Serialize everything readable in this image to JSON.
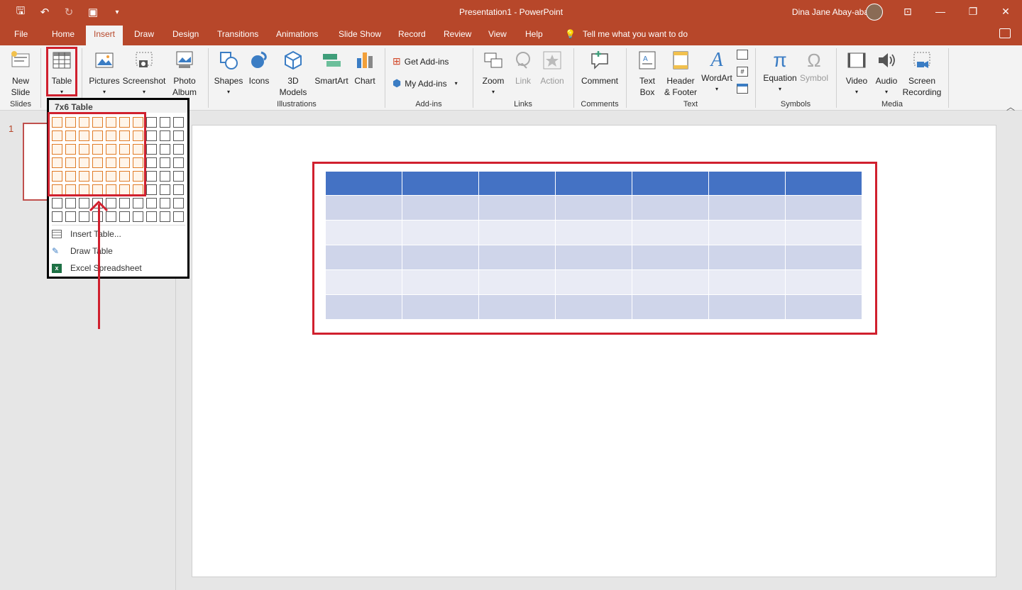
{
  "titlebar": {
    "title": "Presentation1  -  PowerPoint",
    "user": "Dina Jane Abay-abay"
  },
  "tabs": [
    "File",
    "Home",
    "Insert",
    "Draw",
    "Design",
    "Transitions",
    "Animations",
    "Slide Show",
    "Record",
    "Review",
    "View",
    "Help"
  ],
  "tellme": "Tell me what you want to do",
  "ribbon": {
    "new_slide": "New Slide",
    "table": "Table",
    "pictures": "Pictures",
    "screenshot": "Screenshot",
    "photo_album": "Photo Album",
    "shapes": "Shapes",
    "icons": "Icons",
    "models3d": "3D Models",
    "smartart": "SmartArt",
    "chart": "Chart",
    "get_addins": "Get Add-ins",
    "my_addins": "My Add-ins",
    "zoom": "Zoom",
    "link": "Link",
    "action": "Action",
    "comment": "Comment",
    "text_box": "Text Box",
    "header_footer": "Header & Footer",
    "wordart": "WordArt",
    "equation": "Equation",
    "symbol": "Symbol",
    "video": "Video",
    "audio": "Audio",
    "screen_recording": "Screen Recording",
    "groups": {
      "slides": "Slides",
      "illustrations": "Illustrations",
      "addins": "Add-ins",
      "links": "Links",
      "comments": "Comments",
      "text": "Text",
      "symbols": "Symbols",
      "media": "Media"
    }
  },
  "dropdown": {
    "title": "7x6 Table",
    "items": [
      "Insert Table...",
      "Draw Table",
      "Excel Spreadsheet"
    ]
  },
  "slide": {
    "number": "1"
  },
  "colors": {
    "accent": "#b7472a",
    "highlight": "#d0202e",
    "table_header": "#4472c4"
  }
}
